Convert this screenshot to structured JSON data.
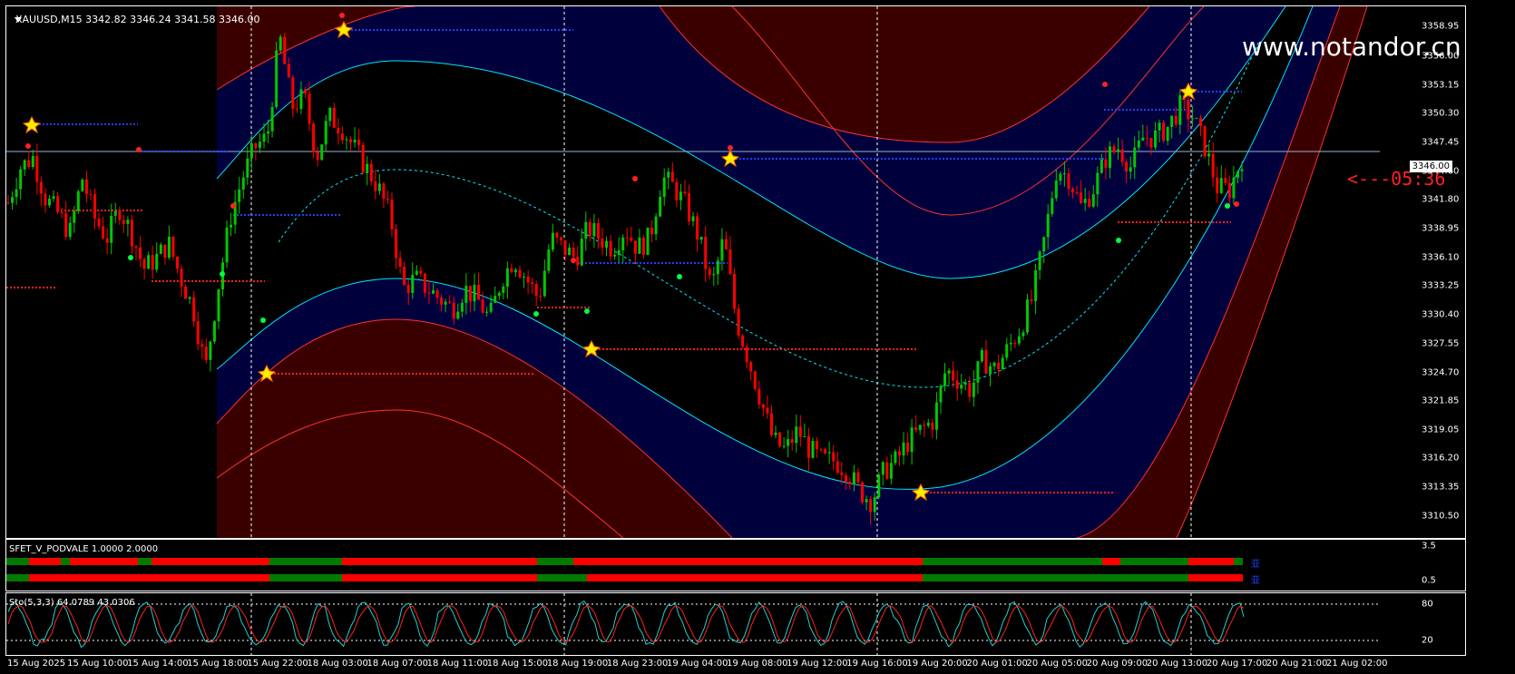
{
  "header": {
    "symbol_line": "XAUUSD,M15  3342.82 3346.24 3341.58 3346.00"
  },
  "watermark": "www.notandor.cn",
  "countdown": "<---05:36",
  "current_price": "3346.00",
  "indicator": {
    "label": "SFET_V_PODVALE 1.0000 2.0000",
    "axis": [
      "3.5",
      "0.5"
    ],
    "row_codes": [
      "亚",
      "亚"
    ]
  },
  "stochastic": {
    "label": "Sto(5,3,3) 64.0789 43.0306",
    "axis": [
      "80",
      "20"
    ]
  },
  "price_axis": [
    "3358.95",
    "3356.00",
    "3353.15",
    "3350.30",
    "3347.45",
    "3346.00",
    "3344.60",
    "3341.80",
    "3338.95",
    "3336.10",
    "3333.25",
    "3330.40",
    "3327.55",
    "3324.70",
    "3321.85",
    "3319.05",
    "3316.20",
    "3313.35",
    "3310.50"
  ],
  "time_axis": [
    "15 Aug 2025",
    "15 Aug 10:00",
    "15 Aug 14:00",
    "15 Aug 18:00",
    "15 Aug 22:00",
    "18 Aug 03:00",
    "18 Aug 07:00",
    "18 Aug 11:00",
    "18 Aug 15:00",
    "18 Aug 19:00",
    "18 Aug 23:00",
    "19 Aug 04:00",
    "19 Aug 08:00",
    "19 Aug 12:00",
    "19 Aug 16:00",
    "19 Aug 20:00",
    "20 Aug 01:00",
    "20 Aug 05:00",
    "20 Aug 09:00",
    "20 Aug 13:00",
    "20 Aug 17:00",
    "20 Aug 21:00",
    "21 Aug 02:00"
  ],
  "colors": {
    "bull": "#00c800",
    "bear": "#ff0000",
    "band_outer": "#3a0000",
    "band_inner": "#00003c",
    "cyan": "#00e5ff",
    "red_line": "#ff3030",
    "grid": "#ffffff"
  },
  "chart_data": {
    "type": "candlestick",
    "ylim": [
      3310.5,
      3358.95
    ],
    "x_labels": [
      "15 Aug 2025",
      "15 Aug 10:00",
      "15 Aug 14:00",
      "15 Aug 18:00",
      "15 Aug 22:00",
      "18 Aug 03:00",
      "18 Aug 07:00",
      "18 Aug 11:00",
      "18 Aug 15:00",
      "18 Aug 19:00",
      "18 Aug 23:00",
      "19 Aug 04:00",
      "19 Aug 08:00",
      "19 Aug 12:00",
      "19 Aug 16:00",
      "19 Aug 20:00",
      "20 Aug 01:00",
      "20 Aug 05:00",
      "20 Aug 09:00",
      "20 Aug 13:00",
      "20 Aug 17:00",
      "20 Aug 21:00",
      "21 Aug 02:00"
    ],
    "close_path": [
      3341.5,
      3345.0,
      3346.0,
      3342.0,
      3340.5,
      3338.5,
      3344.0,
      3340.0,
      3338.0,
      3341.0,
      3338.5,
      3335.0,
      3336.0,
      3337.5,
      3334.0,
      3331.0,
      3325.0,
      3333.0,
      3340.0,
      3344.0,
      3347.0,
      3348.0,
      3358.0,
      3351.0,
      3352.0,
      3346.0,
      3350.0,
      3349.0,
      3347.0,
      3345.0,
      3343.0,
      3340.0,
      3333.0,
      3334.0,
      3333.0,
      3332.0,
      3331.0,
      3333.0,
      3332.0,
      3330.0,
      3334.0,
      3336.0,
      3334.0,
      3332.0,
      3338.0,
      3337.0,
      3336.0,
      3339.0,
      3338.0,
      3337.0,
      3339.0,
      3337.0,
      3338.0,
      3344.0,
      3343.0,
      3341.0,
      3338.0,
      3333.0,
      3338.0,
      3330.0,
      3326.0,
      3322.0,
      3318.0,
      3317.0,
      3319.0,
      3317.0,
      3316.0,
      3316.0,
      3315.0,
      3313.0,
      3312.0,
      3315.0,
      3316.0,
      3318.0,
      3319.0,
      3320.0,
      3325.0,
      3324.0,
      3323.0,
      3326.0,
      3325.0,
      3327.0,
      3329.0,
      3332.0,
      3338.0,
      3345.0,
      3344.0,
      3341.0,
      3343.0,
      3346.0,
      3347.0,
      3345.0,
      3348.0,
      3348.0,
      3349.0,
      3351.0,
      3350.0,
      3347.0,
      3343.0,
      3342.8,
      3346.0
    ],
    "current_price": 3346.0
  }
}
